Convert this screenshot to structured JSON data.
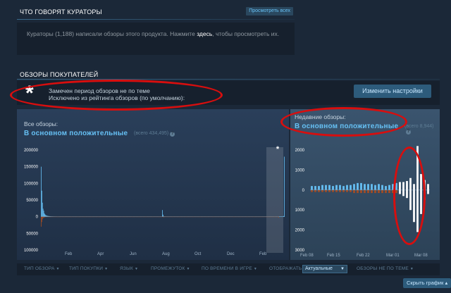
{
  "curators": {
    "title": "ЧТО ГОВОРЯТ КУРАТОРЫ",
    "see_all_label": "Просмотреть всех",
    "text_before": "Кураторы (1,188) написали обзоры этого продукта. Нажмите ",
    "link_label": "здесь",
    "text_after": ", чтобы просмотреть их."
  },
  "reviews": {
    "title": "ОБЗОРЫ ПОКУПАТЕЛЕЙ",
    "notice": {
      "icon": "asterisk-icon",
      "line1": "Замечен период обзоров не по теме",
      "line2": "Исключено из рейтинга обзоров (по умолчанию):",
      "settings_label": "Изменить настройки"
    },
    "all": {
      "label": "Все обзоры:",
      "rating": "В основном положительные",
      "count": "(всего 434,495)",
      "help": "?"
    },
    "recent": {
      "label": "Недавние обзоры:",
      "rating": "В основном положительные",
      "count": "(всего 8,944)",
      "help": "?"
    },
    "filters": [
      {
        "label": "ТИП ОБЗОРА"
      },
      {
        "label": "ТИП ПОКУПКИ"
      },
      {
        "label": "ЯЗЫК"
      },
      {
        "label": "ПРОМЕЖУТОК"
      },
      {
        "label": "ПО ВРЕМЕНИ В ИГРЕ"
      },
      {
        "label": "ОТОБРАЖАТЬ:"
      },
      {
        "label": "ОБЗОРЫ НЕ ПО ТЕМЕ"
      }
    ],
    "display_value": "Актуальные",
    "hide_graph_label": "Скрыть график"
  },
  "colors": {
    "positive": "#66c0f4",
    "negative": "#a34c25",
    "annotation": "#d80e0e"
  },
  "chart_data": [
    {
      "type": "bar",
      "series": [
        {
          "name": "positive",
          "values": [
            150000,
            78000,
            42000,
            24000,
            18000,
            10000,
            7000,
            5000,
            4000,
            3000,
            2500,
            2000,
            1800,
            1500,
            1200,
            1000,
            900,
            800,
            700,
            600,
            500,
            500,
            400,
            400,
            400,
            300,
            300,
            300,
            300,
            300,
            300,
            300,
            300,
            300,
            300,
            300,
            300,
            300,
            300,
            300,
            300,
            300,
            300,
            300,
            300,
            300,
            300,
            300,
            300,
            300,
            300,
            300,
            300,
            300,
            300,
            300,
            300,
            300,
            300,
            300,
            300,
            300,
            300,
            300,
            300,
            300,
            300,
            300,
            300,
            300,
            300,
            300,
            300,
            300,
            300,
            300,
            300,
            300,
            300,
            300,
            300,
            300,
            300,
            300,
            300,
            300,
            300,
            300,
            300,
            300,
            300,
            300,
            300,
            300,
            300,
            300,
            300,
            300,
            300,
            300,
            300,
            300,
            300,
            300,
            300,
            300,
            300,
            300,
            300,
            300,
            300,
            300,
            300,
            300,
            300,
            300,
            300,
            300,
            300,
            300,
            300,
            300,
            300,
            300,
            300,
            300,
            300,
            300,
            300,
            300,
            300,
            300,
            300,
            300,
            300,
            300,
            300,
            300,
            300,
            300,
            300,
            300,
            300,
            300,
            300,
            300,
            300,
            300,
            300,
            300,
            300,
            300,
            300,
            300,
            300,
            300,
            300,
            300,
            300,
            300,
            300,
            300,
            300,
            300,
            300,
            300,
            300,
            300,
            300,
            300,
            300,
            300,
            300,
            300,
            300,
            300,
            300,
            300,
            300,
            300,
            300,
            300,
            300,
            300,
            300,
            300,
            300,
            300,
            300,
            300,
            20000,
            6000,
            800,
            600,
            500,
            400,
            400,
            400,
            300,
            300,
            300,
            300,
            300,
            300,
            300,
            300,
            300,
            300,
            300,
            300,
            300,
            300,
            300,
            300,
            300,
            300,
            300,
            300,
            300,
            300,
            300,
            300,
            300,
            300,
            300,
            300,
            300,
            300,
            300,
            300,
            300,
            300,
            300,
            300,
            300,
            300,
            300,
            300,
            300,
            300,
            300,
            300,
            300,
            300,
            300,
            300,
            300,
            300,
            300,
            300,
            300,
            300,
            300,
            300,
            300,
            300,
            300,
            300,
            300,
            300,
            300,
            300,
            300,
            300,
            300,
            300,
            300,
            300,
            300,
            300,
            300,
            300,
            300,
            300,
            300,
            300,
            300,
            300,
            300,
            300,
            300,
            300,
            300,
            300,
            300,
            300,
            300,
            300,
            300,
            300,
            300,
            300,
            300,
            300,
            300,
            300,
            300,
            300,
            300,
            300,
            300,
            300,
            300,
            300,
            300,
            300,
            300,
            300,
            300,
            300,
            300,
            300,
            300,
            300,
            300,
            300,
            300,
            300,
            300,
            300,
            300,
            300,
            300,
            300,
            300,
            300,
            300,
            300,
            300,
            300,
            300,
            300,
            300,
            300,
            300,
            300,
            300,
            300,
            300,
            300,
            300,
            300,
            300,
            300,
            300,
            300,
            300,
            300,
            300,
            300,
            300,
            300,
            300,
            300,
            300,
            300,
            300,
            300,
            300,
            300,
            300,
            300,
            300,
            300,
            300,
            300,
            300,
            300,
            300,
            300,
            300,
            300,
            300,
            300,
            300,
            300,
            300,
            300,
            300,
            300,
            2000,
            180000
          ]
        },
        {
          "name": "negative",
          "values": [
            -30000,
            -16000,
            -8000,
            -4000,
            -3000,
            -2000,
            -1500,
            -1000,
            -800,
            -600,
            -500,
            -400,
            -400,
            -300,
            -300,
            -300,
            -200,
            -200,
            -200,
            -200,
            -200,
            -200,
            -200,
            -200,
            -200,
            -200,
            -200,
            -200,
            -200,
            -200,
            -200,
            -200,
            -200,
            -200,
            -200,
            -200,
            -200,
            -200,
            -200,
            -200,
            -200,
            -200,
            -200,
            -200,
            -200,
            -200,
            -200,
            -200,
            -200,
            -200,
            -200,
            -200,
            -200,
            -200,
            -200,
            -200,
            -200,
            -200,
            -200,
            -200,
            -200,
            -200,
            -200,
            -200,
            -200,
            -200,
            -200,
            -200,
            -200,
            -200,
            -200,
            -200,
            -200,
            -200,
            -200,
            -200,
            -200,
            -200,
            -200,
            -200,
            -200,
            -200,
            -200,
            -200,
            -200,
            -200,
            -200,
            -200,
            -200,
            -200,
            -200,
            -200,
            -200,
            -200,
            -200,
            -200,
            -200,
            -200,
            -200,
            -200,
            -200,
            -200,
            -200,
            -200,
            -200,
            -200,
            -200,
            -200,
            -200,
            -200,
            -200,
            -200,
            -200,
            -200,
            -200,
            -200,
            -200,
            -200,
            -200,
            -200,
            -200,
            -200,
            -200,
            -200,
            -200,
            -200,
            -200,
            -200,
            -200,
            -200,
            -200,
            -200,
            -200,
            -200,
            -200,
            -200,
            -200,
            -200,
            -200,
            -200,
            -200,
            -200,
            -200,
            -200,
            -200,
            -200,
            -200,
            -200,
            -200,
            -200,
            -200,
            -200,
            -200,
            -200,
            -200,
            -200,
            -200,
            -200,
            -200,
            -200,
            -200,
            -200,
            -200,
            -200,
            -200,
            -200,
            -200,
            -200,
            -200,
            -200,
            -200,
            -200,
            -200,
            -200,
            -200,
            -200,
            -200,
            -200,
            -200,
            -200,
            -200,
            -200,
            -200,
            -200,
            -200,
            -200,
            -200,
            -200,
            -200,
            -200,
            -200,
            -200,
            -2000,
            -800,
            -200,
            -200,
            -200,
            -200,
            -200,
            -200,
            -200,
            -200,
            -200,
            -200,
            -200,
            -200,
            -200,
            -200,
            -200,
            -200,
            -200,
            -200,
            -200,
            -200,
            -200,
            -200,
            -200,
            -200,
            -200,
            -200,
            -200,
            -200,
            -200,
            -200,
            -200,
            -200,
            -200,
            -200,
            -200,
            -200,
            -200,
            -200,
            -200,
            -200,
            -200,
            -200,
            -200,
            -200,
            -200,
            -200,
            -200,
            -200,
            -200,
            -200,
            -200,
            -200,
            -200,
            -200,
            -200,
            -200,
            -200,
            -200,
            -200,
            -200,
            -200,
            -200,
            -200,
            -200,
            -200,
            -200,
            -200,
            -200,
            -200,
            -200,
            -200,
            -200,
            -200,
            -200,
            -200,
            -200,
            -200,
            -200,
            -200,
            -200,
            -200,
            -200,
            -200,
            -200,
            -200,
            -200,
            -200,
            -200,
            -200,
            -200,
            -200,
            -200,
            -200,
            -200,
            -200,
            -200,
            -200,
            -200,
            -200,
            -200,
            -200,
            -200,
            -200,
            -200,
            -200,
            -200,
            -200,
            -200,
            -200,
            -200,
            -200,
            -200,
            -200,
            -200,
            -200,
            -200,
            -200,
            -200,
            -200,
            -200,
            -200,
            -200,
            -200,
            -200,
            -200,
            -200,
            -200,
            -200,
            -200,
            -200,
            -200,
            -200,
            -200,
            -200,
            -200,
            -200,
            -200,
            -200,
            -200,
            -200,
            -200,
            -200,
            -200,
            -200,
            -200,
            -200,
            -200,
            -200,
            -200,
            -200,
            -200,
            -200,
            -200,
            -200,
            -200,
            -200,
            -200,
            -200,
            -200,
            -200,
            -200,
            -200,
            -200,
            -200,
            -200,
            -200,
            -200,
            -200,
            -200,
            -200,
            -200,
            -200,
            -200,
            -200,
            -200,
            -200,
            -200,
            -1000,
            -3000
          ]
        }
      ],
      "y_tick_labels": [
        "200000",
        "150000",
        "100000",
        "50000",
        "0",
        "50000",
        "100000"
      ],
      "ylim": [
        -100000,
        200000
      ],
      "x_tick_labels": [
        "Feb",
        "Apr",
        "Jun",
        "Aug",
        "Oct",
        "Dec",
        "Feb"
      ],
      "excluded_period_marker": "*"
    },
    {
      "type": "bar",
      "series": [
        {
          "name": "positive",
          "values": [
            200,
            200,
            200,
            250,
            250,
            250,
            200,
            250,
            250,
            200,
            250,
            250,
            300,
            350,
            350,
            300,
            300,
            300,
            250,
            300,
            250,
            200,
            250,
            300,
            350,
            400,
            400,
            450,
            600,
            300,
            2200,
            800,
            500,
            300
          ]
        },
        {
          "name": "negative",
          "values": [
            -100,
            -100,
            -100,
            -100,
            -100,
            -100,
            -100,
            -100,
            -100,
            -100,
            -100,
            -100,
            -150,
            -150,
            -150,
            -150,
            -150,
            -150,
            -150,
            -150,
            -150,
            -150,
            -150,
            -150,
            -150,
            -200,
            -300,
            -400,
            -1000,
            -1600,
            -2100,
            -1200,
            -500,
            -200
          ]
        }
      ],
      "y_tick_labels": [
        "2000",
        "1000",
        "0",
        "1000",
        "2000",
        "3000"
      ],
      "ylim": [
        -3000,
        2000
      ],
      "x_tick_labels": [
        "Feb 08",
        "Feb 15",
        "Feb 22",
        "Mar 01",
        "Mar 08"
      ],
      "excluded_period_marker": "*"
    }
  ]
}
